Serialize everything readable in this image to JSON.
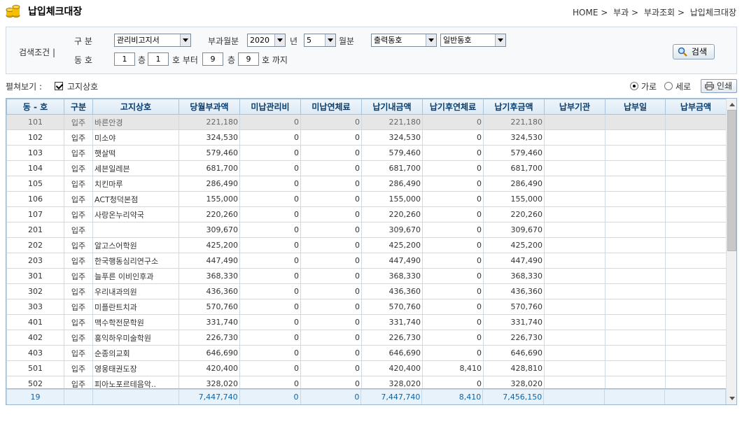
{
  "header": {
    "title": "납입체크대장",
    "breadcrumb": [
      "HOME >",
      "부과 >",
      "부과조회 >",
      "납입체크대장"
    ]
  },
  "search": {
    "label": "검색조건 |",
    "gubun_label": "구  분",
    "gubun_value": "관리비고지서",
    "month_label": "부과월분",
    "year_value": "2020",
    "year_suffix": "년",
    "month_value": "5",
    "month_suffix": "월분",
    "building_select": "출력동호",
    "building_type_select": "일반동호",
    "dongho_label": "동  호",
    "from_dong": "1",
    "from_floor_label": "층",
    "from_ho": "1",
    "from_suffix": "호 부터",
    "to_dong": "9",
    "to_floor_label": "층",
    "to_ho": "9",
    "to_suffix": "호 까지",
    "search_button": "검색"
  },
  "view": {
    "label": "펼쳐보기 :",
    "checkbox_label": "고지상호",
    "radio_horizontal": "가로",
    "radio_vertical": "세로",
    "print_button": "인쇄"
  },
  "table": {
    "columns": [
      "동 - 호",
      "구분",
      "고지상호",
      "당월부과액",
      "미납관리비",
      "미납연체료",
      "납기내금액",
      "납기후연체료",
      "납기후금액",
      "납부기관",
      "납부일",
      "납부금액"
    ],
    "rows": [
      [
        "101",
        "입주",
        "바른안경",
        "221,180",
        "0",
        "0",
        "221,180",
        "0",
        "221,180",
        "",
        "",
        ""
      ],
      [
        "102",
        "입주",
        "미소야",
        "324,530",
        "0",
        "0",
        "324,530",
        "0",
        "324,530",
        "",
        "",
        ""
      ],
      [
        "103",
        "입주",
        "햇살떡",
        "579,460",
        "0",
        "0",
        "579,460",
        "0",
        "579,460",
        "",
        "",
        ""
      ],
      [
        "104",
        "입주",
        "세븐일레븐",
        "681,700",
        "0",
        "0",
        "681,700",
        "0",
        "681,700",
        "",
        "",
        ""
      ],
      [
        "105",
        "입주",
        "치킨마루",
        "286,490",
        "0",
        "0",
        "286,490",
        "0",
        "286,490",
        "",
        "",
        ""
      ],
      [
        "106",
        "입주",
        "ACT청덕본점",
        "155,000",
        "0",
        "0",
        "155,000",
        "0",
        "155,000",
        "",
        "",
        ""
      ],
      [
        "107",
        "입주",
        "사랑온누리약국",
        "220,260",
        "0",
        "0",
        "220,260",
        "0",
        "220,260",
        "",
        "",
        ""
      ],
      [
        "201",
        "입주",
        "",
        "309,670",
        "0",
        "0",
        "309,670",
        "0",
        "309,670",
        "",
        "",
        ""
      ],
      [
        "202",
        "입주",
        "알고스어학원",
        "425,200",
        "0",
        "0",
        "425,200",
        "0",
        "425,200",
        "",
        "",
        ""
      ],
      [
        "203",
        "입주",
        "한국행동심리연구소",
        "447,490",
        "0",
        "0",
        "447,490",
        "0",
        "447,490",
        "",
        "",
        ""
      ],
      [
        "301",
        "입주",
        "늘푸른 이비인후과",
        "368,330",
        "0",
        "0",
        "368,330",
        "0",
        "368,330",
        "",
        "",
        ""
      ],
      [
        "302",
        "입주",
        "우리내과의원",
        "436,360",
        "0",
        "0",
        "436,360",
        "0",
        "436,360",
        "",
        "",
        ""
      ],
      [
        "303",
        "입주",
        "미플란트치과",
        "570,760",
        "0",
        "0",
        "570,760",
        "0",
        "570,760",
        "",
        "",
        ""
      ],
      [
        "401",
        "입주",
        "맥수학전문학원",
        "331,740",
        "0",
        "0",
        "331,740",
        "0",
        "331,740",
        "",
        "",
        ""
      ],
      [
        "402",
        "입주",
        "홍익하우미술학원",
        "226,730",
        "0",
        "0",
        "226,730",
        "0",
        "226,730",
        "",
        "",
        ""
      ],
      [
        "403",
        "입주",
        "순종의교회",
        "646,690",
        "0",
        "0",
        "646,690",
        "0",
        "646,690",
        "",
        "",
        ""
      ],
      [
        "501",
        "입주",
        "영웅태권도장",
        "420,400",
        "0",
        "0",
        "420,400",
        "8,410",
        "428,810",
        "",
        "",
        ""
      ],
      [
        "502",
        "입주",
        "피아노포르테음악..",
        "328,020",
        "0",
        "0",
        "328,020",
        "0",
        "328,020",
        "",
        "",
        ""
      ]
    ],
    "footer": [
      "19",
      "",
      "",
      "7,447,740",
      "0",
      "0",
      "7,447,740",
      "8,410",
      "7,456,150",
      "",
      "",
      ""
    ]
  }
}
